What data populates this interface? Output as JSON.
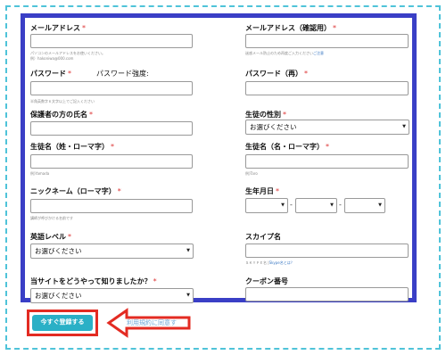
{
  "form": {
    "email_label": "メールアドレス",
    "email_confirm_label": "メールアドレス（確認用）",
    "email_hint_1": "パソコンのメールアドレスをお使いください。",
    "email_hint_2": "例）hakoniwa@000.com",
    "email_confirm_hint_pre": "迷惑メール防止のため再度ご入力ください",
    "email_confirm_hint_link": "ご注意",
    "password_label": "パスワード",
    "password_strength_label": "パスワード強度:",
    "password_confirm_label": "パスワード（再）",
    "password_hint": "半角英数字６文字以上でご記入ください",
    "guardian_name_label": "保護者の方の氏名",
    "student_gender_label": "生徒の性別",
    "student_gender_value": "お選びください",
    "last_name_label": "生徒名（姓・ローマ字）",
    "last_name_hint": "例)Yamada",
    "first_name_label": "生徒名（名・ローマ字）",
    "first_name_hint": "例)Taro",
    "nickname_label": "ニックネーム（ローマ字）",
    "nickname_hint": "講師が呼びかける名前です",
    "birthday_label": "生年月日",
    "english_level_label": "英語レベル",
    "english_level_value": "お選びください",
    "skype_label": "スカイプ名",
    "skype_hint_pre": "ＳＫＹＰＥ名 |",
    "skype_hint_link": "Skype名とは？",
    "source_label": "当サイトをどうやって知りましたか？",
    "source_value": "お選びください",
    "coupon_label": "クーポン番号",
    "required_mark": "*",
    "date_separator": "-",
    "select_arrow": "▼"
  },
  "actions": {
    "submit_label": "今すぐ登録する",
    "terms_text": "利用規約に同意す"
  },
  "colors": {
    "form_border": "#3a3fc6",
    "outer_dashed": "#4fc3d9",
    "submit_button": "#2ab0c6",
    "highlight_red": "#e32b22"
  }
}
